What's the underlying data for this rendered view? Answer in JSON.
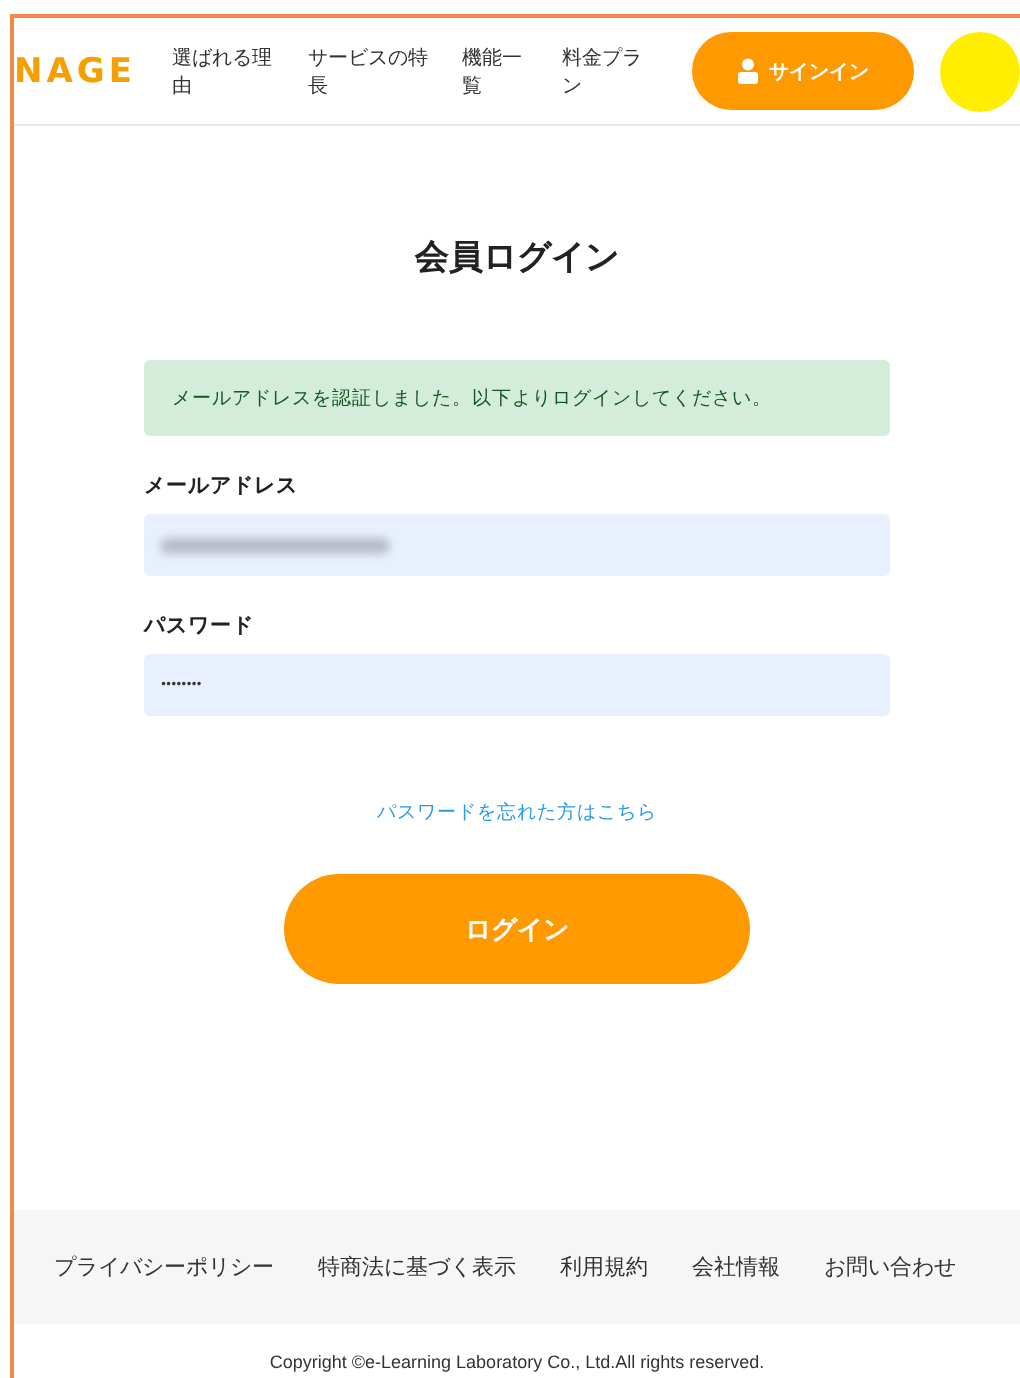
{
  "header": {
    "logo": "NAGE",
    "nav": [
      "選ばれる理由",
      "サービスの特長",
      "機能一覧",
      "料金プラン"
    ],
    "signin_button": "サインイン"
  },
  "login": {
    "title": "会員ログイン",
    "alert": "メールアドレスを認証しました。以下よりログインしてください。",
    "fields": [
      {
        "label": "メールアドレス",
        "kind": "blurred"
      },
      {
        "label": "パスワード",
        "kind": "masked",
        "value": "••••••••"
      }
    ],
    "forgot_link": "パスワードを忘れた方はこちら",
    "submit_button": "ログイン"
  },
  "footer": {
    "links": [
      "プライバシーポリシー",
      "特商法に基づく表示",
      "利用規約",
      "会社情報",
      "お問い合わせ"
    ],
    "copyright": "Copyright ©e-Learning Laboratory Co., Ltd.All rights reserved."
  }
}
